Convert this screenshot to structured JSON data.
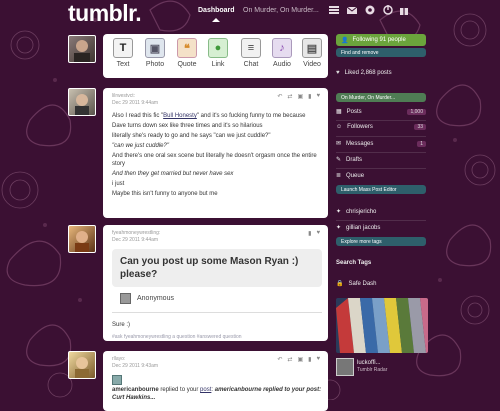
{
  "header": {
    "logo": "tumblr.",
    "nav": {
      "dashboard": "Dashboard",
      "blog": "On Murder, On Murder..."
    },
    "icons": [
      "list-icon",
      "mail-icon",
      "gear-icon",
      "power-icon",
      "gift-icon"
    ]
  },
  "post_types": [
    {
      "label": "Text",
      "glyph": "T",
      "icon": "text-post-icon",
      "color": "#f3f3f3"
    },
    {
      "label": "Photo",
      "glyph": "▣",
      "icon": "photo-post-icon",
      "color": "#dfe6ee"
    },
    {
      "label": "Quote",
      "glyph": "❝",
      "icon": "quote-post-icon",
      "color": "#f4e1c8"
    },
    {
      "label": "Link",
      "glyph": "●",
      "icon": "link-post-icon",
      "color": "#d6efd2"
    },
    {
      "label": "Chat",
      "glyph": "≡",
      "icon": "chat-post-icon",
      "color": "#f1f1f1"
    },
    {
      "label": "Audio",
      "glyph": "♪",
      "icon": "audio-post-icon",
      "color": "#e6dcf0"
    },
    {
      "label": "Video",
      "glyph": "▤",
      "icon": "video-post-icon",
      "color": "#e7e7e7"
    }
  ],
  "posts": [
    {
      "author": "lilrwestvct:",
      "date": "Dec 29 2011 9:44am",
      "lines": [
        "Also I read this fic \"",
        "Bull Honesty",
        "\" and it's so fucking funny to me because",
        "Dave turns down sex like three times and it's so hilarious",
        "literally she's ready to go and he says \"can we just cuddle?\"",
        "\"can we just cuddle?\"",
        "And there's one oral sex scene but literally he doesn't orgasm once the entire story",
        "And then they get married but never have sex",
        "i just",
        "Maybe this isn't funny to anyone but me"
      ]
    },
    {
      "author": "fyeahmoneywrestling:",
      "date": "Dec 29 2011 9:44am",
      "question": "Can you post up some Mason Ryan :) please?",
      "asker": "Anonymous",
      "answer": "Sure :)",
      "tags": "#ask fyeahmoneywrestling a question   #answered question"
    },
    {
      "author": "rllayo:",
      "date": "Dec 29 2011 9:43am",
      "reblog_from": "americanbourne",
      "reblog_verb": " replied to your ",
      "reblog_post": "post",
      "reblog_quote": "americanbourne replied to your post: Curt Hawkins...",
      "reblog_end": ":"
    }
  ],
  "sidebar": {
    "following": "Following 91 people",
    "find_blogs": "Find and remove",
    "liked": "Liked 2,868 posts",
    "blog_button": "On Murder, On Murder...",
    "posts": "Posts",
    "posts_count": "1,000",
    "followers": "Followers",
    "followers_count": "33",
    "messages": "Messages",
    "messages_count": "1",
    "drafts": "Drafts",
    "queue": "Queue",
    "launch": "Launch Mass Post Editor",
    "blog2": "chrisjericho",
    "blog3": "gillian jacobs",
    "explore": "Explore more tags",
    "search_tags": "Search Tags",
    "safe_dash": "Safe Dash",
    "radar_user": "luckoffi...",
    "radar_label": "Tumblr Radar"
  },
  "colors": {
    "background": "#3b1033",
    "follow_green": "#6ba43c",
    "teal_button": "#2e5f6b",
    "blog_button": "#4f7c54"
  }
}
